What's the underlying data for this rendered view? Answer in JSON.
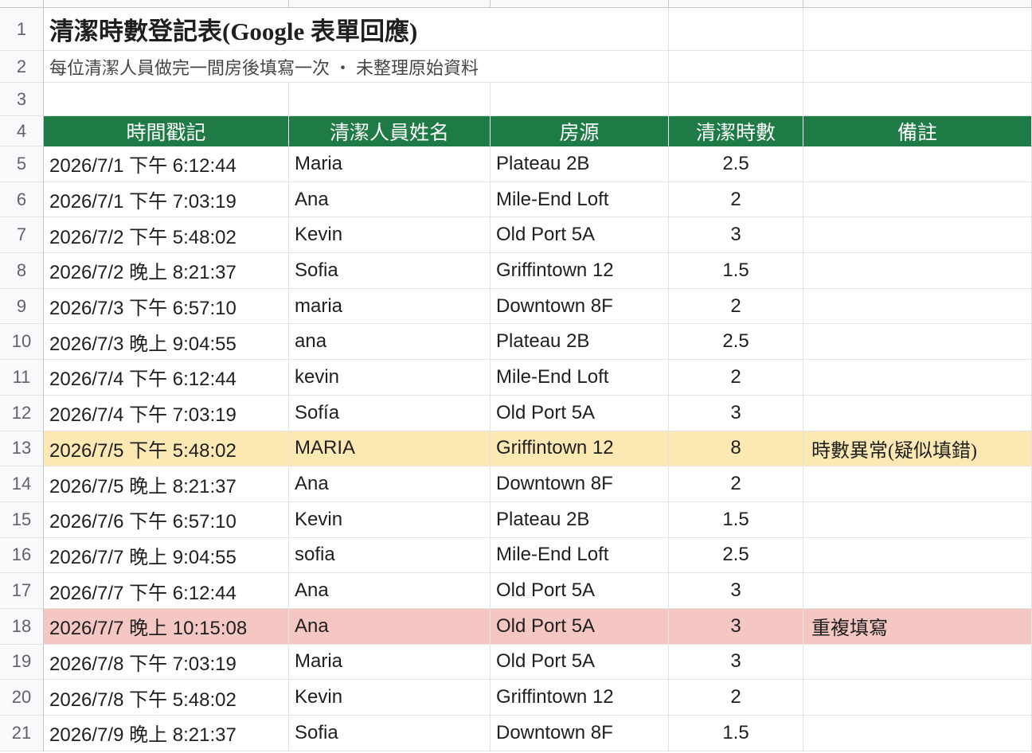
{
  "sheet": {
    "title": "清潔時數登記表(Google 表單回應)",
    "subtitle": "每位清潔人員做完一間房後填寫一次 ・ 未整理原始資料",
    "headers": [
      "時間戳記",
      "清潔人員姓名",
      "房源",
      "清潔時數",
      "備註"
    ],
    "row_numbers": [
      "1",
      "2",
      "3",
      "4",
      "5",
      "6",
      "7",
      "8",
      "9",
      "10",
      "11",
      "12",
      "13",
      "14",
      "15",
      "16",
      "17",
      "18",
      "19",
      "20",
      "21"
    ],
    "rows": [
      {
        "timestamp": "2026/7/1 下午 6:12:44",
        "name": "Maria",
        "listing": "Plateau 2B",
        "hours": "2.5",
        "note": "",
        "flag": ""
      },
      {
        "timestamp": "2026/7/1 下午 7:03:19",
        "name": "Ana",
        "listing": "Mile-End Loft",
        "hours": "2",
        "note": "",
        "flag": ""
      },
      {
        "timestamp": "2026/7/2 下午 5:48:02",
        "name": "Kevin",
        "listing": "Old Port 5A",
        "hours": "3",
        "note": "",
        "flag": ""
      },
      {
        "timestamp": "2026/7/2 晚上 8:21:37",
        "name": "Sofia",
        "listing": "Griffintown 12",
        "hours": "1.5",
        "note": "",
        "flag": ""
      },
      {
        "timestamp": "2026/7/3 下午 6:57:10",
        "name": "maria",
        "listing": "Downtown 8F",
        "hours": "2",
        "note": "",
        "flag": ""
      },
      {
        "timestamp": "2026/7/3 晚上 9:04:55",
        "name": "ana",
        "listing": "Plateau 2B",
        "hours": "2.5",
        "note": "",
        "flag": ""
      },
      {
        "timestamp": "2026/7/4 下午 6:12:44",
        "name": "kevin",
        "listing": "Mile-End Loft",
        "hours": "2",
        "note": "",
        "flag": ""
      },
      {
        "timestamp": "2026/7/4 下午 7:03:19",
        "name": "Sofía",
        "listing": "Old Port 5A",
        "hours": "3",
        "note": "",
        "flag": ""
      },
      {
        "timestamp": "2026/7/5 下午 5:48:02",
        "name": "MARIA",
        "listing": "Griffintown 12",
        "hours": "8",
        "note": "時數異常(疑似填錯)",
        "flag": "warn"
      },
      {
        "timestamp": "2026/7/5 晚上 8:21:37",
        "name": "Ana",
        "listing": "Downtown 8F",
        "hours": "2",
        "note": "",
        "flag": ""
      },
      {
        "timestamp": "2026/7/6 下午 6:57:10",
        "name": "Kevin",
        "listing": "Plateau 2B",
        "hours": "1.5",
        "note": "",
        "flag": ""
      },
      {
        "timestamp": "2026/7/7 晚上 9:04:55",
        "name": "sofia",
        "listing": "Mile-End Loft",
        "hours": "2.5",
        "note": "",
        "flag": ""
      },
      {
        "timestamp": "2026/7/7 下午 6:12:44",
        "name": "Ana",
        "listing": "Old Port 5A",
        "hours": "3",
        "note": "",
        "flag": ""
      },
      {
        "timestamp": "2026/7/7 晚上 10:15:08",
        "name": "Ana",
        "listing": "Old Port 5A",
        "hours": "3",
        "note": "重複填寫",
        "flag": "dup"
      },
      {
        "timestamp": "2026/7/8 下午 7:03:19",
        "name": "Maria",
        "listing": "Old Port 5A",
        "hours": "3",
        "note": "",
        "flag": ""
      },
      {
        "timestamp": "2026/7/8 下午 5:48:02",
        "name": "Kevin",
        "listing": "Griffintown 12",
        "hours": "2",
        "note": "",
        "flag": ""
      },
      {
        "timestamp": "2026/7/9 晚上 8:21:37",
        "name": "Sofia",
        "listing": "Downtown 8F",
        "hours": "1.5",
        "note": "",
        "flag": ""
      }
    ]
  },
  "colors": {
    "header_bg": "#1e7b45",
    "warn_bg": "#fce8b2",
    "duplicate_bg": "#f4c7c3"
  }
}
